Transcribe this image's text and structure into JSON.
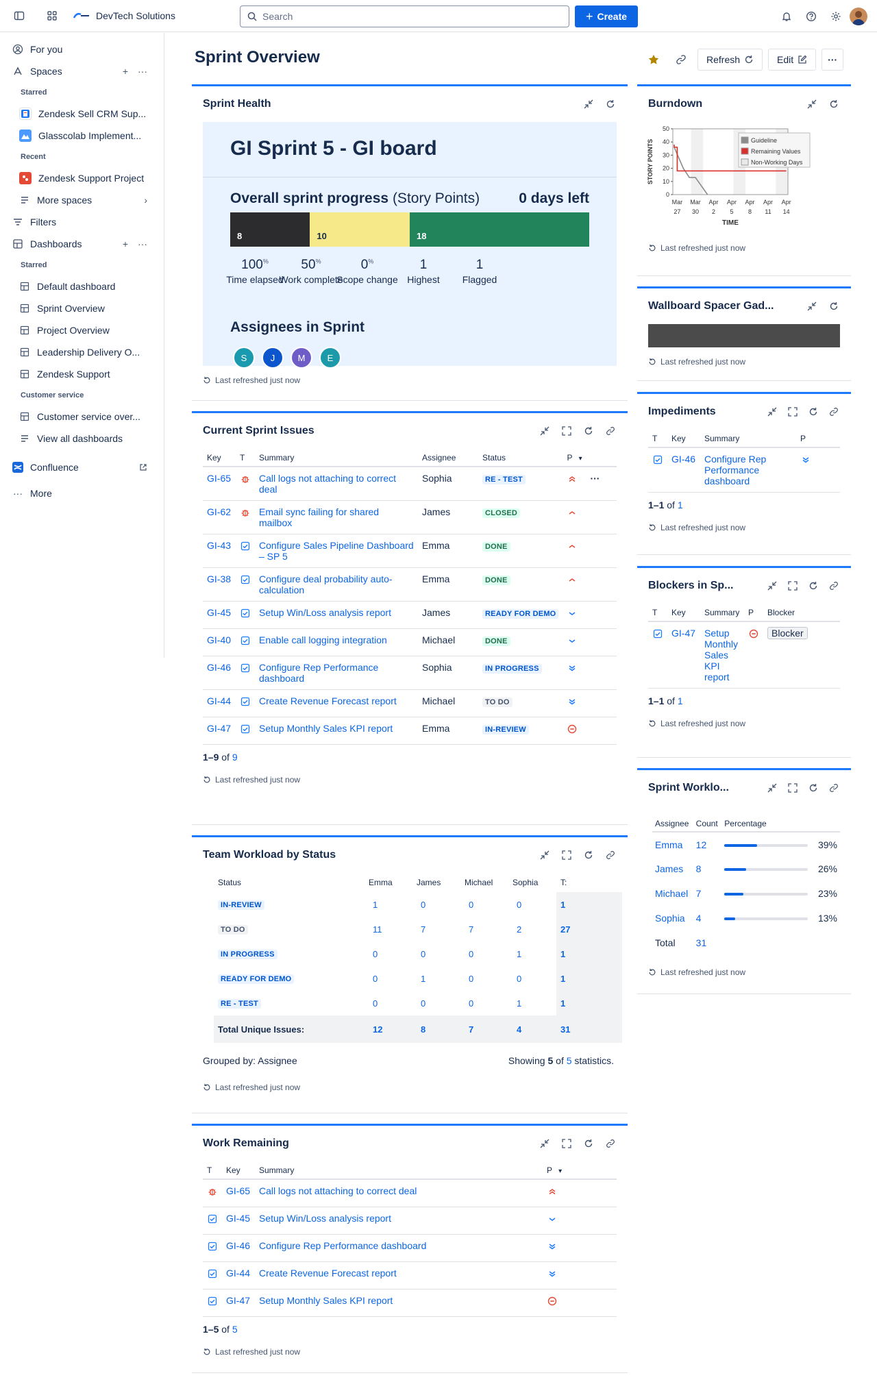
{
  "topbar": {
    "org_name": "DevTech Solutions",
    "search_placeholder": "Search",
    "create_label": "Create"
  },
  "sidebar": {
    "for_you": "For you",
    "spaces": "Spaces",
    "starred_label": "Starred",
    "starred_spaces": [
      "Zendesk Sell CRM Sup...",
      "Glasscolab Implement..."
    ],
    "recent_label": "Recent",
    "recent_spaces": [
      "Zendesk Support Project"
    ],
    "more_spaces": "More spaces",
    "filters": "Filters",
    "dashboards": "Dashboards",
    "dash_starred_label": "Starred",
    "dash_starred": [
      "Default dashboard",
      "Sprint Overview",
      "Project Overview",
      "Leadership Delivery O...",
      "Zendesk Support"
    ],
    "customer_service_label": "Customer service",
    "customer_service": [
      "Customer service over..."
    ],
    "view_all": "View all dashboards",
    "confluence": "Confluence",
    "more": "More"
  },
  "page": {
    "title": "Sprint Overview",
    "refresh": "Refresh",
    "edit": "Edit"
  },
  "refreshed_text": "Last refreshed just now",
  "sprint_health": {
    "gadget_title": "Sprint Health",
    "sprint_name": "GI Sprint 5 - GI board",
    "progress_label": "Overall sprint progress",
    "progress_unit": "(Story Points)",
    "days_left": "0 days left",
    "segments": [
      {
        "value": "8",
        "fraction": 0.2222,
        "color": "#2c2c2e"
      },
      {
        "value": "10",
        "fraction": 0.2778,
        "color": "#f5e989"
      },
      {
        "value": "18",
        "fraction": 0.5,
        "color": "#22845a"
      }
    ],
    "stats": [
      {
        "num": "100",
        "suffix": "%",
        "label": "Time elapsed"
      },
      {
        "num": "50",
        "suffix": "%",
        "label": "Work complete"
      },
      {
        "num": "0",
        "suffix": "%",
        "label": "Scope change"
      },
      {
        "num": "1",
        "suffix": "",
        "label": "Highest"
      },
      {
        "num": "1",
        "suffix": "",
        "label": "Flagged"
      }
    ],
    "assignees_label": "Assignees in Sprint",
    "assignees": [
      {
        "initial": "S",
        "color": "#1a9aaf"
      },
      {
        "initial": "J",
        "color": "#0c55cc"
      },
      {
        "initial": "M",
        "color": "#6e5dc6"
      },
      {
        "initial": "E",
        "color": "#1d9aaa"
      }
    ]
  },
  "current_issues": {
    "gadget_title": "Current Sprint Issues",
    "headers": {
      "key": "Key",
      "type": "T",
      "summary": "Summary",
      "assignee": "Assignee",
      "status": "Status",
      "priority": "P"
    },
    "rows": [
      {
        "key": "GI-65",
        "type": "bug",
        "summary": "Call logs not attaching to correct deal",
        "assignee": "Sophia",
        "status": "RE - TEST",
        "status_style": "blue",
        "priority": "highest"
      },
      {
        "key": "GI-62",
        "type": "bug",
        "summary": "Email sync failing for shared mailbox",
        "assignee": "James",
        "status": "CLOSED",
        "status_style": "green",
        "priority": "high"
      },
      {
        "key": "GI-43",
        "type": "task",
        "summary": "Configure Sales Pipeline Dashboard – SP 5",
        "assignee": "Emma",
        "status": "DONE",
        "status_style": "green",
        "priority": "high"
      },
      {
        "key": "GI-38",
        "type": "task",
        "summary": "Configure deal probability auto-calculation",
        "assignee": "Emma",
        "status": "DONE",
        "status_style": "green",
        "priority": "high"
      },
      {
        "key": "GI-45",
        "type": "task",
        "summary": "Setup Win/Loss analysis report",
        "assignee": "James",
        "status": "READY FOR DEMO",
        "status_style": "blue",
        "priority": "low"
      },
      {
        "key": "GI-40",
        "type": "task",
        "summary": "Enable call logging integration",
        "assignee": "Michael",
        "status": "DONE",
        "status_style": "green",
        "priority": "low"
      },
      {
        "key": "GI-46",
        "type": "task",
        "summary": "Configure Rep Performance dashboard",
        "assignee": "Sophia",
        "status": "IN PROGRESS",
        "status_style": "blue",
        "priority": "lowest"
      },
      {
        "key": "GI-44",
        "type": "task",
        "summary": "Create Revenue Forecast report",
        "assignee": "Michael",
        "status": "TO DO",
        "status_style": "grey",
        "priority": "lowest"
      },
      {
        "key": "GI-47",
        "type": "task",
        "summary": "Setup Monthly Sales KPI report",
        "assignee": "Emma",
        "status": "IN-REVIEW",
        "status_style": "blue",
        "priority": "blocker"
      }
    ],
    "pager_range": "1–9",
    "pager_of": "of",
    "pager_total": "9"
  },
  "team_workload": {
    "gadget_title": "Team Workload by Status",
    "headers": [
      "Status",
      "Emma",
      "James",
      "Michael",
      "Sophia",
      "T:"
    ],
    "rows": [
      {
        "status": "IN-REVIEW",
        "style": "blue",
        "values": [
          "1",
          "0",
          "0",
          "0"
        ],
        "total": "1"
      },
      {
        "status": "TO DO",
        "style": "grey",
        "values": [
          "11",
          "7",
          "7",
          "2"
        ],
        "total": "27"
      },
      {
        "status": "IN PROGRESS",
        "style": "blue",
        "values": [
          "0",
          "0",
          "0",
          "1"
        ],
        "total": "1"
      },
      {
        "status": "READY FOR DEMO",
        "style": "blue",
        "values": [
          "0",
          "1",
          "0",
          "0"
        ],
        "total": "1"
      },
      {
        "status": "RE - TEST",
        "style": "blue",
        "values": [
          "0",
          "0",
          "0",
          "1"
        ],
        "total": "1"
      }
    ],
    "total_label": "Total Unique Issues:",
    "totals": [
      "12",
      "8",
      "7",
      "4"
    ],
    "grand_total": "31",
    "grouped_by": "Grouped by: Assignee",
    "showing_prefix": "Showing",
    "showing_count": "5",
    "showing_of": "of",
    "showing_total": "5",
    "showing_suffix": "statistics."
  },
  "work_remaining": {
    "gadget_title": "Work Remaining",
    "headers": {
      "type": "T",
      "key": "Key",
      "summary": "Summary",
      "priority": "P"
    },
    "rows": [
      {
        "type": "bug",
        "key": "GI-65",
        "summary": "Call logs not attaching to correct deal",
        "priority": "highest"
      },
      {
        "type": "task",
        "key": "GI-45",
        "summary": "Setup Win/Loss analysis report",
        "priority": "low"
      },
      {
        "type": "task",
        "key": "GI-46",
        "summary": "Configure Rep Performance dashboard",
        "priority": "lowest"
      },
      {
        "type": "task",
        "key": "GI-44",
        "summary": "Create Revenue Forecast report",
        "priority": "lowest"
      },
      {
        "type": "task",
        "key": "GI-47",
        "summary": "Setup Monthly Sales KPI report",
        "priority": "blocker"
      }
    ],
    "pager_range": "1–5",
    "pager_of": "of",
    "pager_total": "5"
  },
  "burndown": {
    "gadget_title": "Burndown"
  },
  "chart_data": {
    "type": "line",
    "title": "",
    "xlabel": "TIME",
    "ylabel": "STORY POINTS",
    "ylim": [
      0,
      50
    ],
    "yticks": [
      "0",
      "10",
      "20",
      "30",
      "40",
      "50"
    ],
    "xticks": [
      {
        "month": "Mar",
        "day": "27"
      },
      {
        "month": "Mar",
        "day": "30"
      },
      {
        "month": "Apr",
        "day": "2"
      },
      {
        "month": "Apr",
        "day": "5"
      },
      {
        "month": "Apr",
        "day": "8"
      },
      {
        "month": "Apr",
        "day": "11"
      },
      {
        "month": "Apr",
        "day": "14"
      }
    ],
    "x_dates": [
      "Mar 27",
      "Mar 28",
      "Mar 29",
      "Mar 30",
      "Mar 31",
      "Apr 1",
      "Apr 2",
      "Apr 3",
      "Apr 4",
      "Apr 5",
      "Apr 6",
      "Apr 7",
      "Apr 8",
      "Apr 9",
      "Apr 10",
      "Apr 11",
      "Apr 12",
      "Apr 13",
      "Apr 14"
    ],
    "series": [
      {
        "name": "Guideline",
        "color": "#8c8c8c",
        "points": [
          [
            "Mar 26",
            36
          ],
          [
            "Mar 28",
            20
          ],
          [
            "Mar 29",
            13
          ],
          [
            "Mar 30",
            13
          ],
          [
            "Apr 1",
            0
          ]
        ]
      },
      {
        "name": "Remaining Values",
        "color": "#d9302c",
        "points": [
          [
            "Mar 26",
            38
          ],
          [
            "Mar 26",
            36
          ],
          [
            "Mar 27",
            36
          ],
          [
            "Mar 27",
            18
          ],
          [
            "Apr 14",
            18
          ]
        ]
      },
      {
        "name": "Non-Working Days",
        "color": "#f0f0f0",
        "points": []
      }
    ],
    "legend": "top-right",
    "grid": false
  },
  "spacer": {
    "gadget_title": "Wallboard Spacer Gad..."
  },
  "impediments": {
    "gadget_title": "Impediments",
    "headers": {
      "type": "T",
      "key": "Key",
      "summary": "Summary",
      "priority": "P"
    },
    "rows": [
      {
        "type": "task",
        "key": "GI-46",
        "summary": "Configure Rep Performance dashboard",
        "priority": "lowest"
      }
    ],
    "pager_range": "1–1",
    "pager_of": "of",
    "pager_total": "1"
  },
  "blockers": {
    "gadget_title": "Blockers in Sp...",
    "headers": {
      "type": "T",
      "key": "Key",
      "summary": "Summary",
      "priority": "P",
      "blocker": "Blocker"
    },
    "rows": [
      {
        "type": "task",
        "key": "GI-47",
        "summary": "Setup Monthly Sales KPI report",
        "priority": "blocker",
        "blocker": "Blocker"
      }
    ],
    "pager_range": "1–1",
    "pager_of": "of",
    "pager_total": "1"
  },
  "sprint_workload": {
    "gadget_title": "Sprint Worklo...",
    "headers": [
      "Assignee",
      "Count",
      "Percentage"
    ],
    "rows": [
      {
        "name": "Emma",
        "count": "12",
        "pct": "39%",
        "fraction": 0.39
      },
      {
        "name": "James",
        "count": "8",
        "pct": "26%",
        "fraction": 0.26
      },
      {
        "name": "Michael",
        "count": "7",
        "pct": "23%",
        "fraction": 0.23
      },
      {
        "name": "Sophia",
        "count": "4",
        "pct": "13%",
        "fraction": 0.13
      }
    ],
    "total_label": "Total",
    "total": "31"
  }
}
